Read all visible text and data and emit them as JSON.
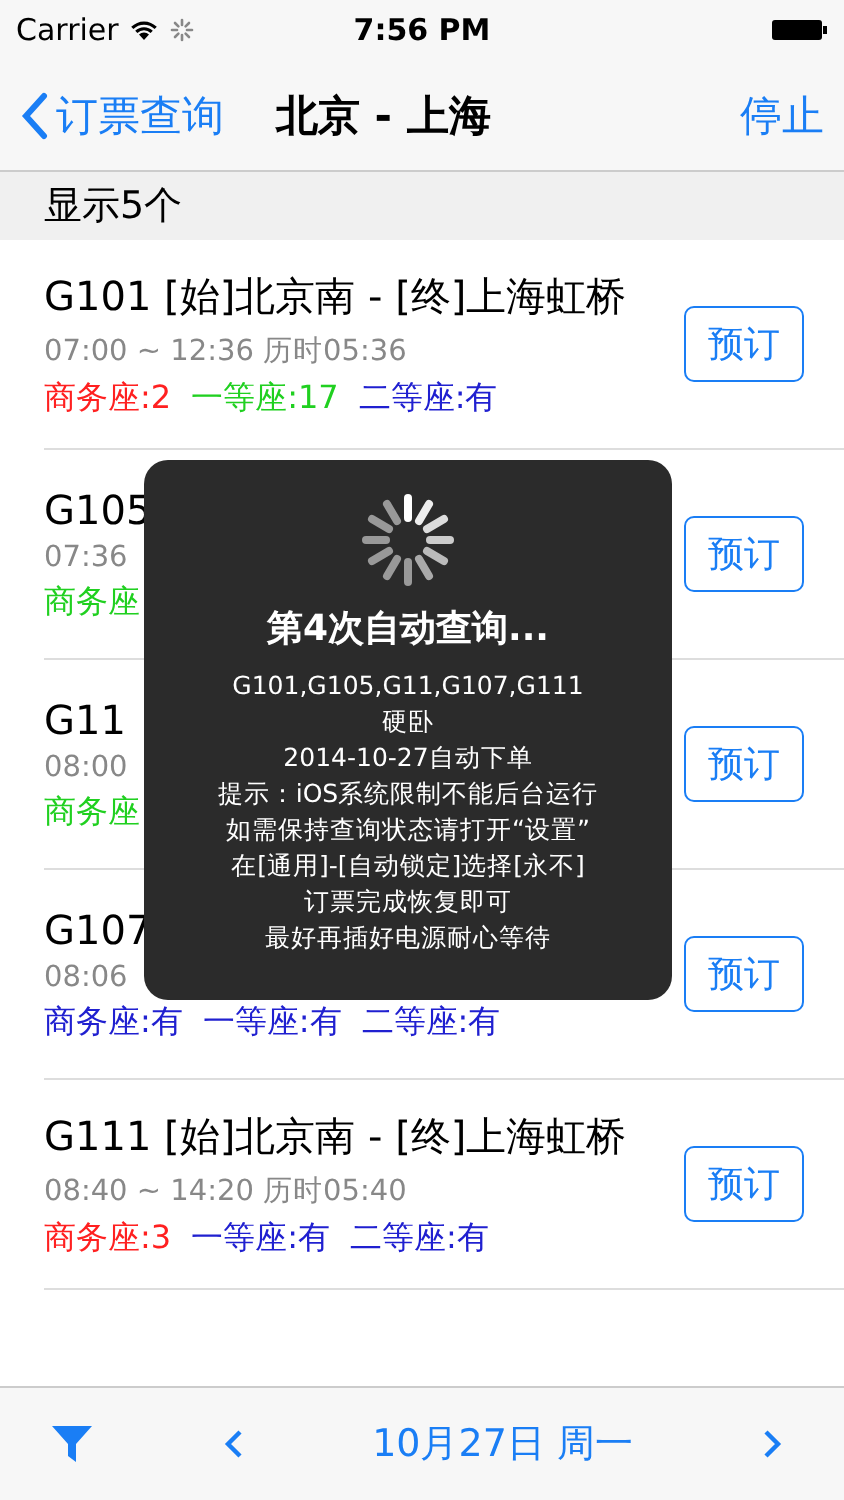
{
  "status_bar": {
    "carrier": "Carrier",
    "time": "7:56 PM"
  },
  "nav": {
    "back": "订票查询",
    "title": "北京 - 上海",
    "action": "停止"
  },
  "section_header": "显示5个",
  "trains": [
    {
      "title": "G101 [始]北京南 - [终]上海虹桥",
      "times": "07:00 ~ 12:36 历时05:36",
      "button": "预订",
      "seats": [
        {
          "text": "商务座:2",
          "color": "#ff2020"
        },
        {
          "text": "一等座:17",
          "color": "#20d020"
        },
        {
          "text": "二等座:有",
          "color": "#2020d0"
        }
      ]
    },
    {
      "title": "G105",
      "times": "07:36",
      "button": "预订",
      "seats": [
        {
          "text": "商务座",
          "color": "#20d020"
        }
      ]
    },
    {
      "title": "G11",
      "times": "08:00",
      "button": "预订",
      "seats": [
        {
          "text": "商务座",
          "color": "#20d020"
        }
      ]
    },
    {
      "title": "G107",
      "times": "08:06",
      "button": "预订",
      "seats": [
        {
          "text": "商务座:有",
          "color": "#2020d0"
        },
        {
          "text": "一等座:有",
          "color": "#2020d0"
        },
        {
          "text": "二等座:有",
          "color": "#2020d0"
        }
      ]
    },
    {
      "title": "G111 [始]北京南 - [终]上海虹桥",
      "times": "08:40 ~ 14:20 历时05:40",
      "button": "预订",
      "seats": [
        {
          "text": "商务座:3",
          "color": "#ff2020"
        },
        {
          "text": "一等座:有",
          "color": "#2020d0"
        },
        {
          "text": "二等座:有",
          "color": "#2020d0"
        }
      ]
    }
  ],
  "hud": {
    "title": "第4次自动查询...",
    "lines": [
      "G101,G105,G11,G107,G111",
      "硬卧",
      "2014-10-27自动下单",
      "提示：iOS系统限制不能后台运行",
      "如需保持查询状态请打开“设置”",
      "在[通用]-[自动锁定]选择[永不]",
      "订票完成恢复即可",
      "最好再插好电源耐心等待"
    ]
  },
  "toolbar": {
    "date": "10月27日 周一"
  }
}
